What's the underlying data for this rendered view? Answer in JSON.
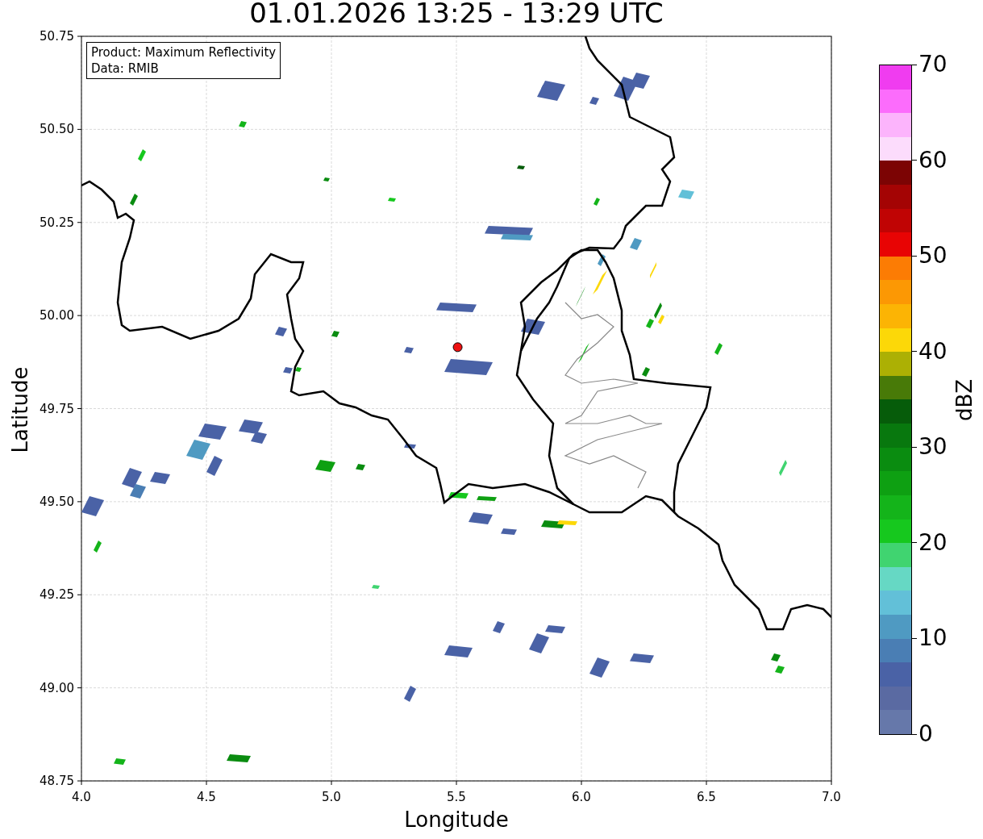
{
  "figure": {
    "title": "01.01.2026 13:25 - 13:29 UTC"
  },
  "info_box": {
    "lines": [
      "Product: Maximum Reflectivity",
      "Data: RMIB"
    ]
  },
  "map": {
    "chart_data": {
      "type": "scatter",
      "xlabel": "Longitude",
      "ylabel": "Latitude",
      "xlim": [
        4,
        7
      ],
      "ylim": [
        48.75,
        50.75
      ],
      "xticks": [
        {
          "value": 4,
          "label": "4.0"
        },
        {
          "value": 4.5,
          "label": "4.5"
        },
        {
          "value": 5,
          "label": "5.0"
        },
        {
          "value": 5.5,
          "label": "5.5"
        },
        {
          "value": 6,
          "label": "6.0"
        },
        {
          "value": 6.5,
          "label": "6.5"
        },
        {
          "value": 7,
          "label": "7.0"
        }
      ],
      "yticks": [
        {
          "value": 48.75,
          "label": "48.75"
        },
        {
          "value": 49,
          "label": "49.00"
        },
        {
          "value": 49.25,
          "label": "49.25"
        },
        {
          "value": 49.5,
          "label": "49.50"
        },
        {
          "value": 49.75,
          "label": "49.75"
        },
        {
          "value": 50,
          "label": "50.00"
        },
        {
          "value": 50.25,
          "label": "50.25"
        },
        {
          "value": 50.5,
          "label": "50.50"
        },
        {
          "value": 50.75,
          "label": "50.75"
        }
      ],
      "grid": true
    }
  },
  "colorbar": {
    "label": "dBZ",
    "ticks": [
      "70",
      "60",
      "50",
      "40",
      "30",
      "20",
      "10",
      "0"
    ]
  }
}
